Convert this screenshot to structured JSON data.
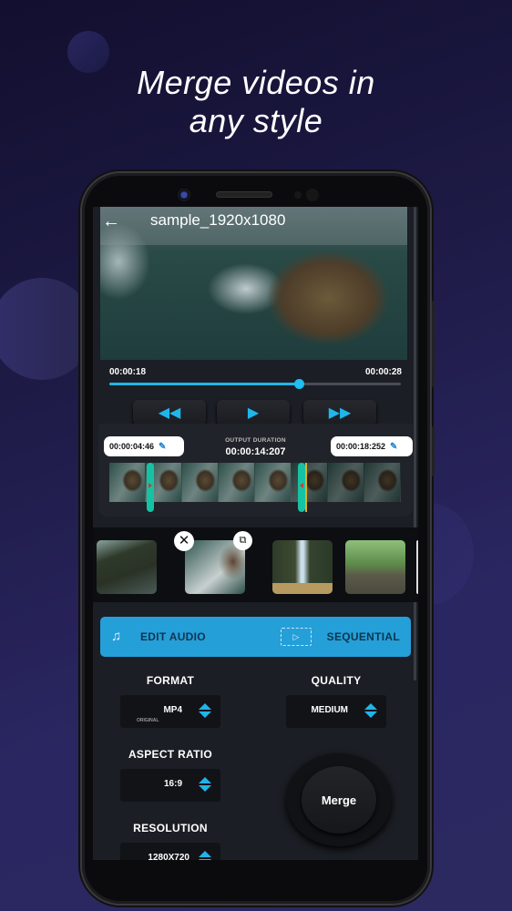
{
  "headline": {
    "line1": "Merge videos in",
    "line2": "any style"
  },
  "player": {
    "title": "sample_1920x1080",
    "back_icon": "←",
    "current_time": "00:00:18",
    "total_time": "00:00:28",
    "progress_percent": 65,
    "controls": {
      "rewind_icon": "◀◀",
      "play_icon": "▶",
      "forward_icon": "▶▶"
    }
  },
  "trim": {
    "start_time": "00:00:04:46",
    "end_time": "00:00:18:252",
    "edit_icon": "✎",
    "output_label": "OUTPUT DURATION",
    "output_value": "00:00:14:207",
    "start_fraction": 0.14,
    "end_fraction": 0.66
  },
  "clips": {
    "close_icon": "✕",
    "duplicate_icon": "⧉",
    "items": [
      "rock-cliff",
      "ocean-rocks",
      "waterfall",
      "forest"
    ]
  },
  "actions": {
    "edit_audio_icon": "♫",
    "edit_audio_label": "EDIT AUDIO",
    "sequential_icon": "▷",
    "sequential_label": "SEQUENTIAL"
  },
  "options": {
    "format_label": "FORMAT",
    "format_value": "MP4",
    "format_sub": "ORIGINAL",
    "quality_label": "QUALITY",
    "quality_value": "MEDIUM",
    "aspect_label": "ASPECT RATIO",
    "aspect_value": "16:9",
    "resolution_label": "RESOLUTION",
    "resolution_value": "1280X720"
  },
  "merge_button": "Merge",
  "colors": {
    "accent": "#1fb6ea",
    "action_bar": "#259fd8",
    "trim_handle": "#15c3a4"
  }
}
